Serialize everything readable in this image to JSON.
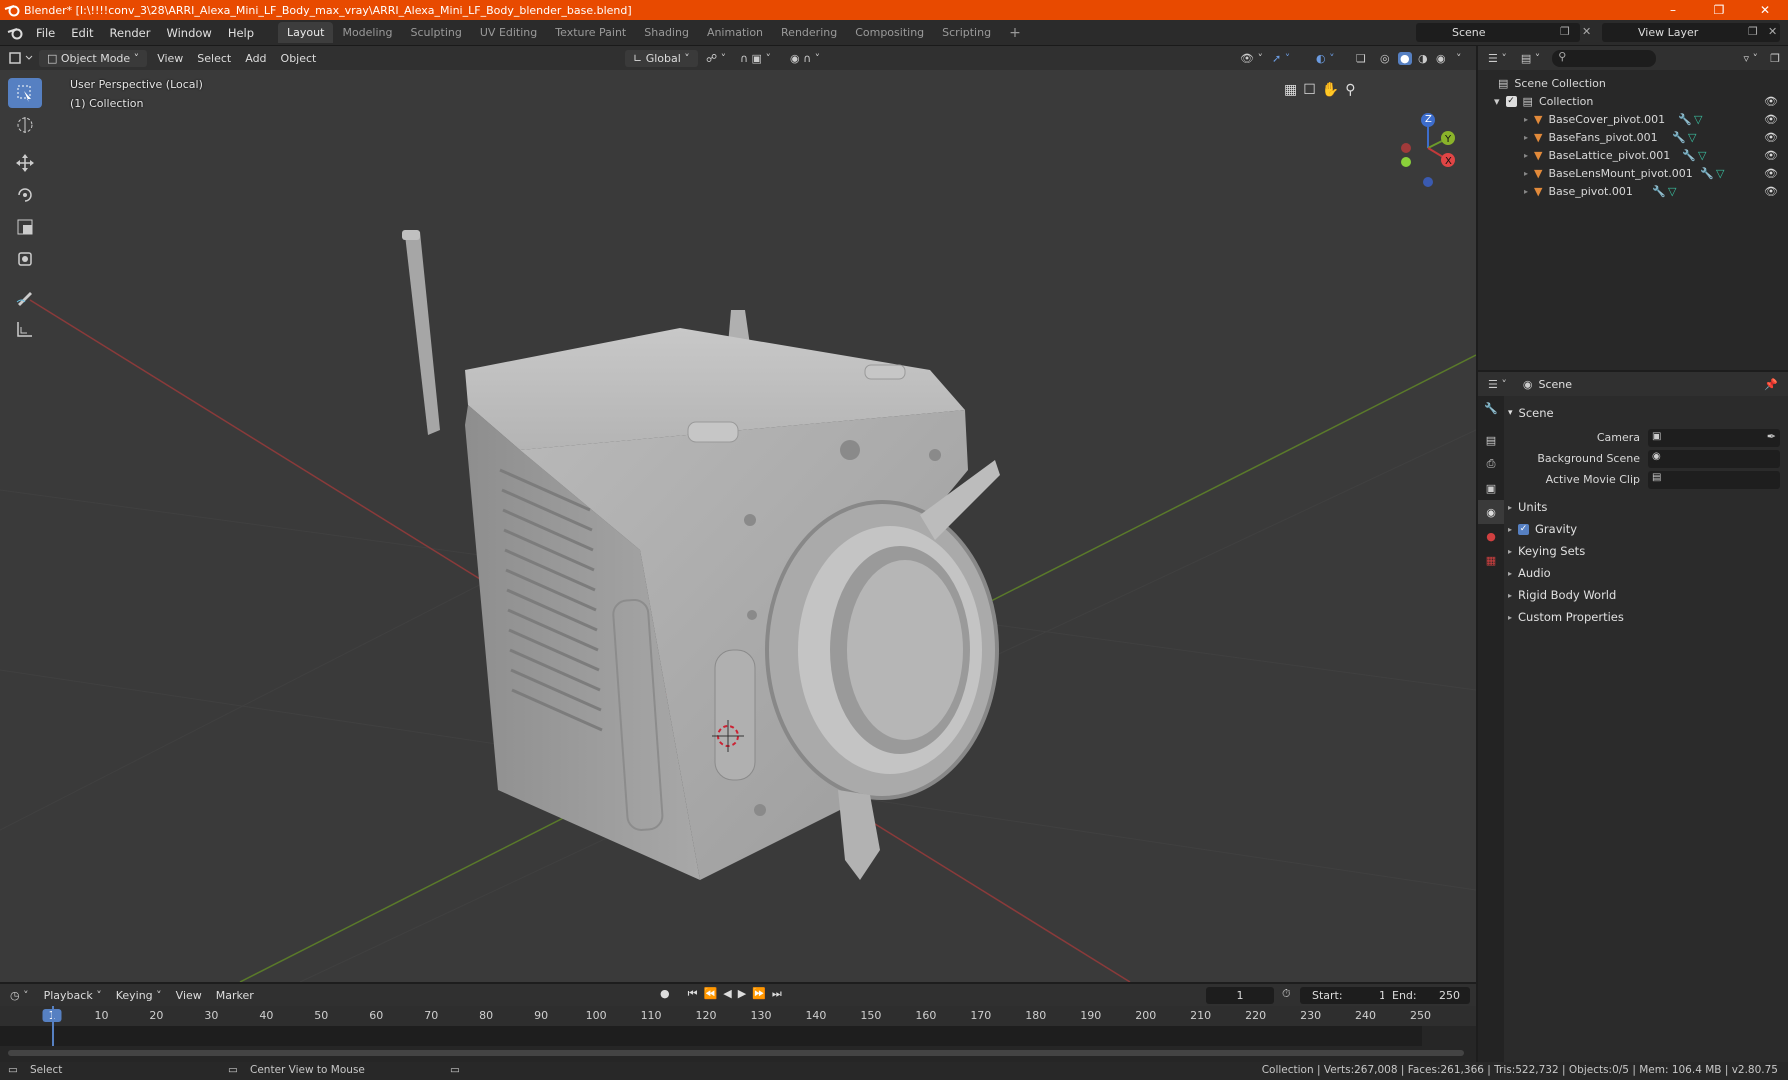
{
  "window": {
    "title": "Blender* [I:\\!!!!conv_3\\28\\ARRI_Alexa_Mini_LF_Body_max_vray\\ARRI_Alexa_Mini_LF_Body_blender_base.blend]",
    "accent": "#e84a00"
  },
  "menu": [
    "File",
    "Edit",
    "Render",
    "Window",
    "Help"
  ],
  "workspaces": [
    "Layout",
    "Modeling",
    "Sculpting",
    "UV Editing",
    "Texture Paint",
    "Shading",
    "Animation",
    "Rendering",
    "Compositing",
    "Scripting"
  ],
  "active_workspace": "Layout",
  "scene_name": "Scene",
  "view_layer": "View Layer",
  "viewport_header": {
    "mode": "Object Mode",
    "menus": [
      "View",
      "Select",
      "Add",
      "Object"
    ],
    "orientation": "Global"
  },
  "viewport": {
    "perspective": "User Perspective (Local)",
    "collection": "(1) Collection",
    "axes": [
      "X",
      "Y",
      "Z"
    ]
  },
  "outliner": {
    "root": "Scene Collection",
    "collection": "Collection",
    "objects": [
      "BaseCover_pivot.001",
      "BaseFans_pivot.001",
      "BaseLattice_pivot.001",
      "BaseLensMount_pivot.001",
      "Base_pivot.001"
    ]
  },
  "properties": {
    "context": "Scene",
    "panel": "Scene",
    "fields": [
      {
        "label": "Camera"
      },
      {
        "label": "Background Scene"
      },
      {
        "label": "Active Movie Clip"
      }
    ],
    "subpanels": [
      "Units",
      "Gravity",
      "Keying Sets",
      "Audio",
      "Rigid Body World",
      "Custom Properties"
    ],
    "gravity_checked": true
  },
  "timeline": {
    "menus": [
      "Playback",
      "Keying",
      "View",
      "Marker"
    ],
    "current_frame": "1",
    "start_label": "Start:",
    "start": "1",
    "end_label": "End:",
    "end": "250",
    "ticks": [
      "1",
      "10",
      "20",
      "30",
      "40",
      "50",
      "60",
      "70",
      "80",
      "90",
      "100",
      "110",
      "120",
      "130",
      "140",
      "150",
      "160",
      "170",
      "180",
      "190",
      "200",
      "210",
      "220",
      "230",
      "240",
      "250"
    ]
  },
  "statusbar": {
    "left": "Select",
    "middle": "Center View to Mouse",
    "right": "Collection | Verts:267,008 | Faces:261,366 | Tris:522,732 | Objects:0/5 | Mem: 106.4 MB | v2.80.75"
  }
}
